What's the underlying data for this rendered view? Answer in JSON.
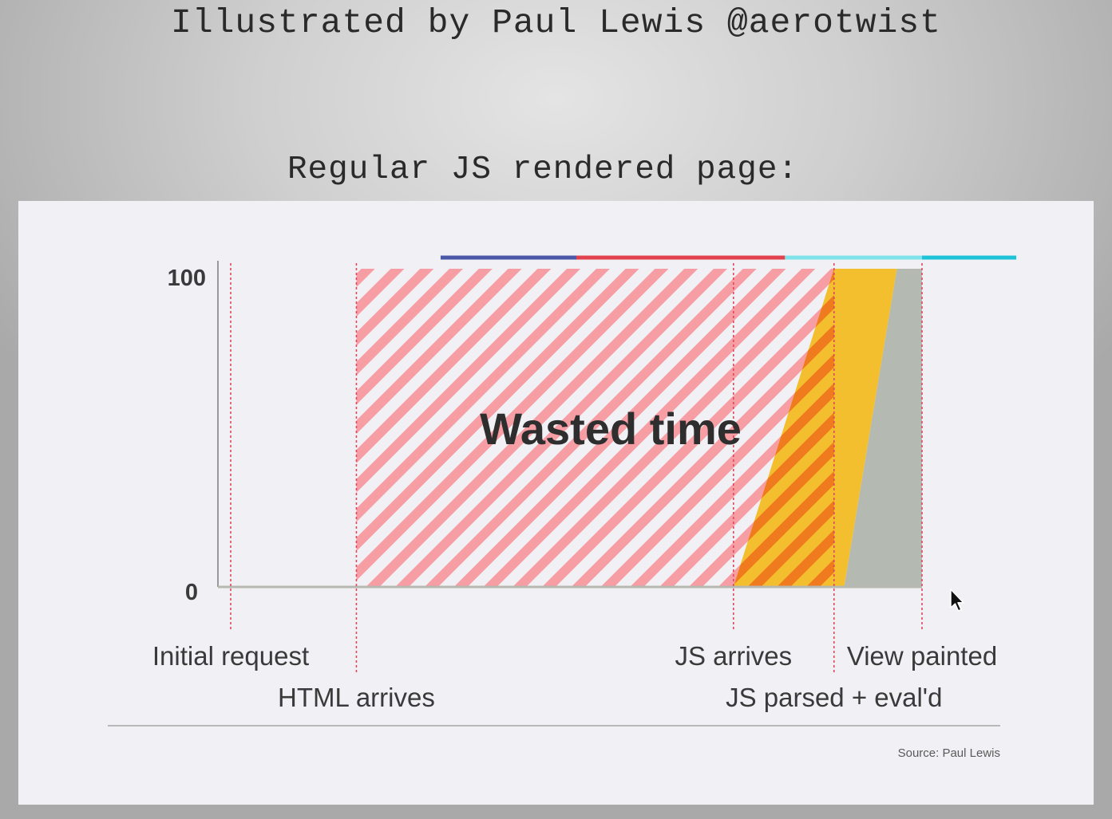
{
  "caption": "Illustrated by Paul Lewis @aerotwist",
  "subtitle": "Regular JS rendered page:",
  "source": "Source: Paul Lewis",
  "chart_data": {
    "type": "area",
    "title": "",
    "ylim": [
      0,
      100
    ],
    "y_ticks": [
      "100",
      "0"
    ],
    "annotation": "Wasted time",
    "events": [
      {
        "label": "Initial request",
        "t": 0
      },
      {
        "label": "HTML arrives",
        "t": 1
      },
      {
        "label": "JS arrives",
        "t": 4
      },
      {
        "label": "JS parsed + eval'd",
        "t": 4.8
      },
      {
        "label": "View painted",
        "t": 5.5
      }
    ],
    "xlim": [
      0,
      5.5
    ],
    "phase_bar": [
      {
        "from": 1.67,
        "to": 2.75,
        "color": "#4a58a8"
      },
      {
        "from": 2.75,
        "to": 4.41,
        "color": "#e2424e"
      },
      {
        "from": 4.41,
        "to": 5.5,
        "color": "#7ee3ea"
      },
      {
        "from": 5.5,
        "to": 6.25,
        "color": "#1ec3d8"
      }
    ],
    "regions": [
      {
        "name": "wasted",
        "pattern": "hatch",
        "color": "#f79da4",
        "polygon": [
          [
            1,
            0
          ],
          [
            1,
            100
          ],
          [
            4.8,
            100
          ],
          [
            4.8,
            0
          ]
        ]
      },
      {
        "name": "parse",
        "color": "#f3bf2e",
        "polygon": [
          [
            4.0,
            0
          ],
          [
            4.8,
            100
          ],
          [
            5.3,
            100
          ],
          [
            4.88,
            0
          ]
        ]
      },
      {
        "name": "paint",
        "color": "#b4bab2",
        "polygon": [
          [
            4.88,
            0
          ],
          [
            5.3,
            100
          ],
          [
            5.5,
            100
          ],
          [
            5.5,
            0
          ]
        ]
      }
    ],
    "grid": false,
    "legend": "none"
  }
}
